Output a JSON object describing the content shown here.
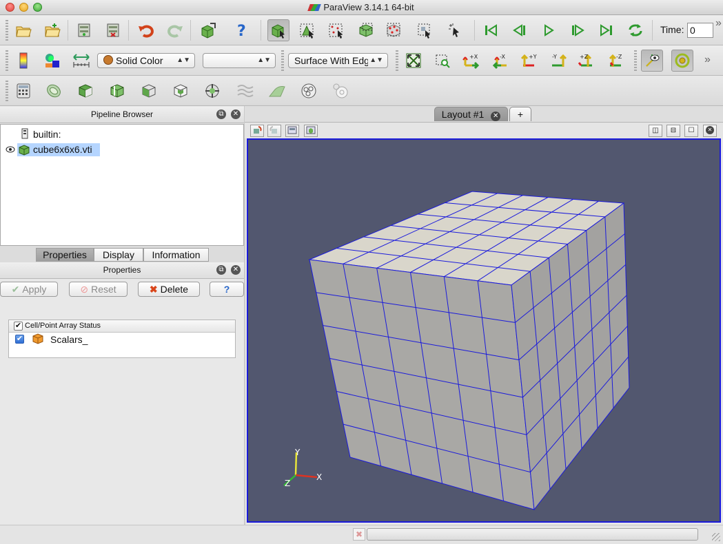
{
  "window": {
    "title": "ParaView 3.14.1 64-bit"
  },
  "toolbar_main": {
    "time_label": "Time:",
    "time_value": "0",
    "overflow": "»"
  },
  "toolbar_display": {
    "color_by": "Solid Color",
    "component": "",
    "representation": "Surface With Edges",
    "camera_labels": {
      "px": "+X",
      "mx": "-X",
      "py": "+Y",
      "my": "-Y",
      "pz": "+Z",
      "mz": "-Z"
    },
    "overflow": "»"
  },
  "pipeline": {
    "header": "Pipeline Browser",
    "items": [
      {
        "label": "builtin:"
      },
      {
        "label": "cube6x6x6.vti"
      }
    ]
  },
  "tabs": [
    {
      "label": "Properties"
    },
    {
      "label": "Display"
    },
    {
      "label": "Information"
    }
  ],
  "properties": {
    "header": "Properties",
    "apply": "Apply",
    "reset": "Reset",
    "delete": "Delete",
    "help": "?",
    "array_header": "Cell/Point Array Status",
    "arrays": [
      {
        "label": "Scalars_",
        "checked": true
      }
    ]
  },
  "layout": {
    "tab_label": "Layout #1",
    "add_tab": "+"
  },
  "orientation_axes": {
    "x": "X",
    "y": "Y",
    "z": "Z"
  },
  "colors": {
    "viewport_bg": "#52576f",
    "active_view_border": "#1a1adb",
    "selection": "#b5d5ff"
  }
}
